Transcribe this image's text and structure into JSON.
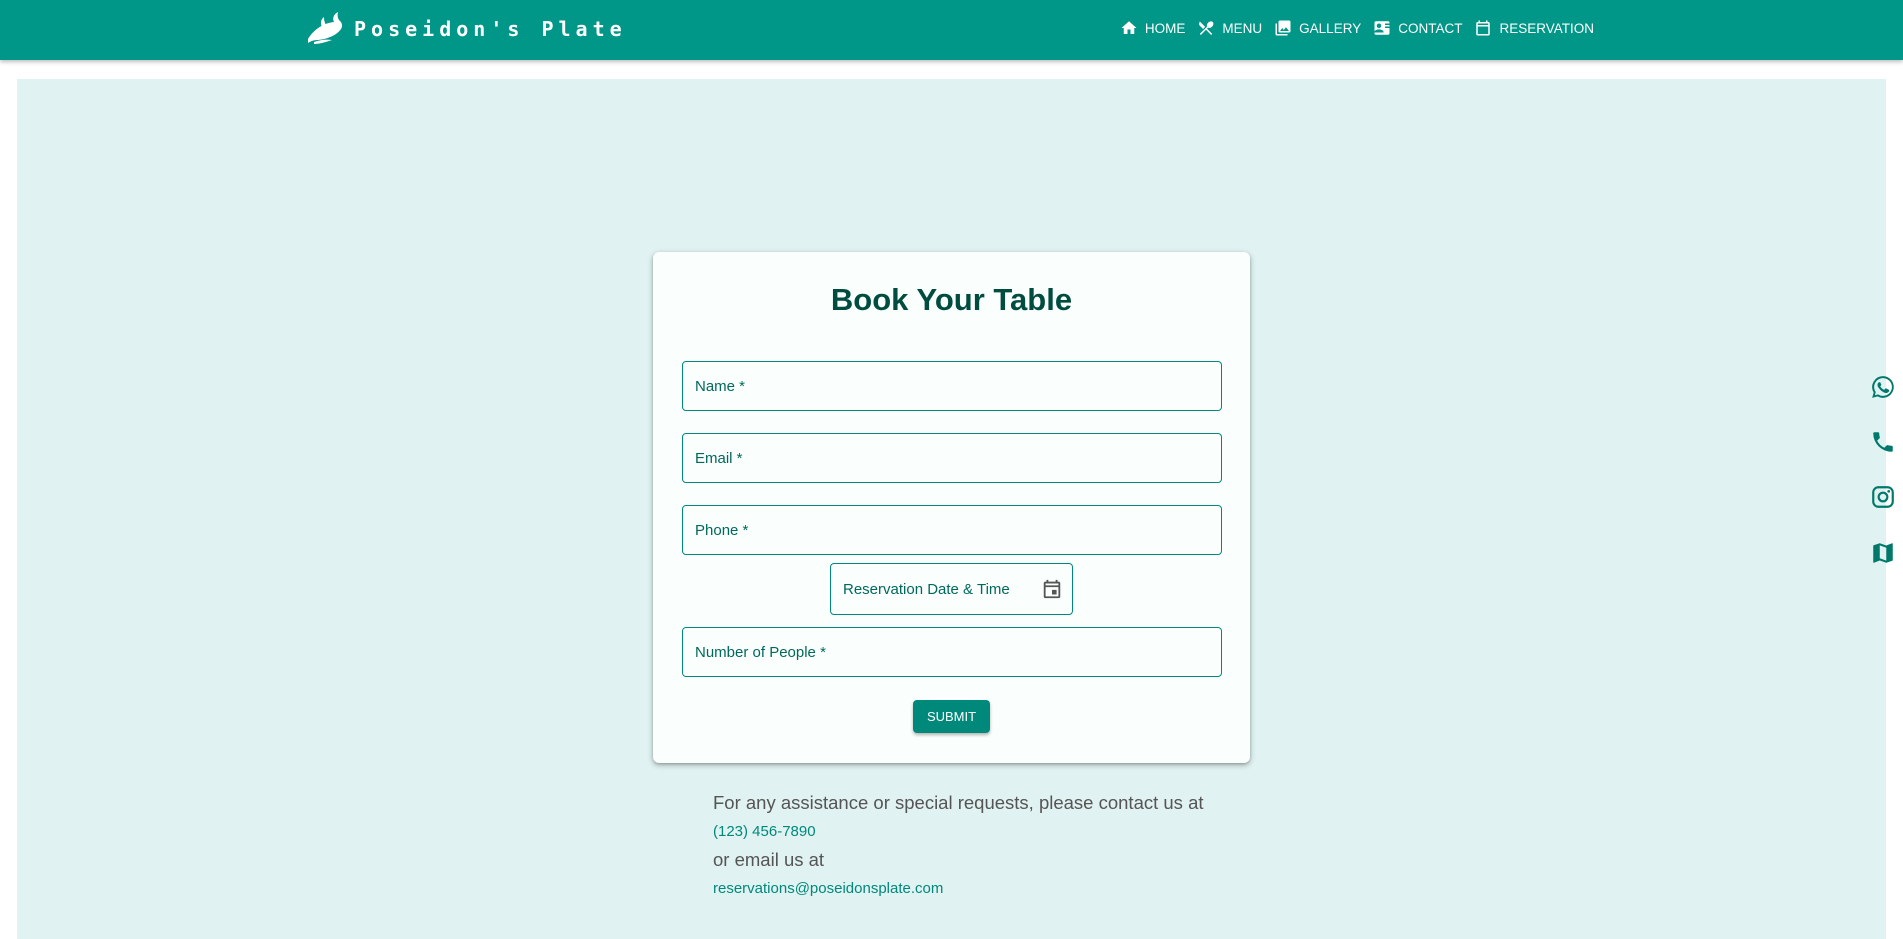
{
  "brand": {
    "name": "Poseidon's Plate",
    "logo_icon": "dolphin-logo-icon"
  },
  "nav": {
    "items": [
      {
        "label": "HOME",
        "icon": "home-icon"
      },
      {
        "label": "MENU",
        "icon": "utensils-icon"
      },
      {
        "label": "GALLERY",
        "icon": "gallery-icon"
      },
      {
        "label": "CONTACT",
        "icon": "contact-card-icon"
      },
      {
        "label": "RESERVATION",
        "icon": "calendar-icon"
      }
    ]
  },
  "form": {
    "title": "Book Your Table",
    "name_label": "Name *",
    "email_label": "Email *",
    "phone_label": "Phone *",
    "datetime_label": "Reservation Date & Time",
    "people_label": "Number of People *",
    "submit_label": "SUBMIT"
  },
  "contact_info": {
    "line1": "For any assistance or special requests, please contact us at",
    "phone": "(123) 456-7890",
    "line2": "or email us at",
    "email": "reservations@poseidonsplate.com"
  },
  "side_icons": [
    "whatsapp-icon",
    "phone-icon",
    "instagram-icon",
    "map-icon"
  ],
  "colors": {
    "primary": "#009688",
    "background": "#e0f2f1",
    "title": "#004d40",
    "accent": "#00897b"
  }
}
